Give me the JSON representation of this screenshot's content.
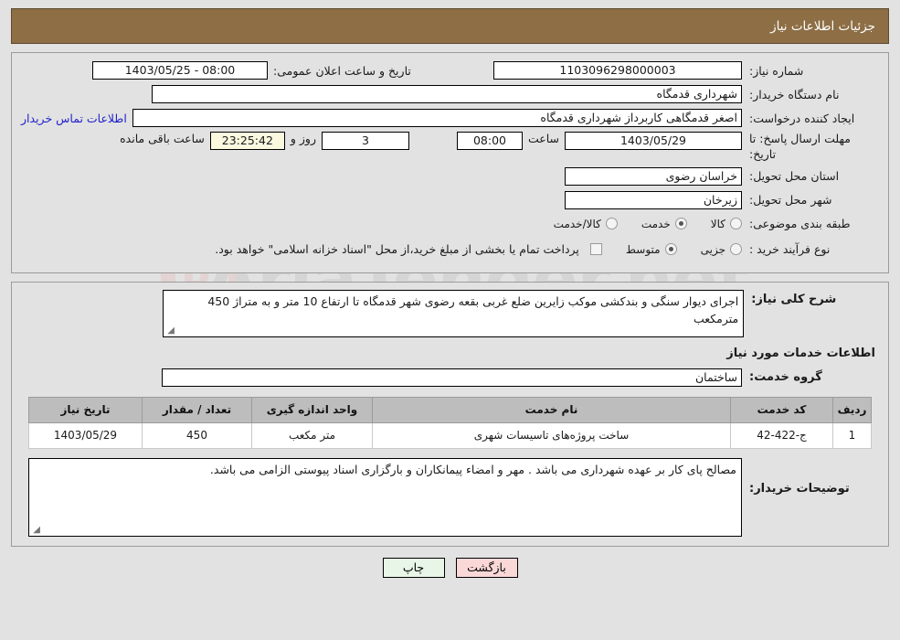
{
  "header": {
    "title": "جزئیات اطلاعات نیاز"
  },
  "top_form": {
    "need_number_label": "شماره نیاز:",
    "need_number_value": "1103096298000003",
    "public_announce_label": "تاریخ و ساعت اعلان عمومی:",
    "public_announce_value": "08:00 - 1403/05/25",
    "buyer_org_label": "نام دستگاه خریدار:",
    "buyer_org_value": "شهرداری قدمگاه",
    "requester_label": "ایجاد کننده درخواست:",
    "requester_value": "اصغر قدمگاهی کاربرداز شهرداری قدمگاه",
    "contact_link": "اطلاعات تماس خریدار",
    "deadline_label": "مهلت ارسال پاسخ: تا تاریخ:",
    "deadline_date": "1403/05/29",
    "hour_label": "ساعت",
    "deadline_time": "08:00",
    "days_value": "3",
    "days_label": "روز و",
    "countdown_value": "23:25:42",
    "countdown_label": "ساعت باقی مانده",
    "province_label": "استان محل تحویل:",
    "province_value": "خراسان رضوی",
    "city_label": "شهر محل تحویل:",
    "city_value": "زیرخان",
    "category_label": "طبقه بندی موضوعی:",
    "category_options": [
      {
        "label": "کالا",
        "selected": false
      },
      {
        "label": "خدمت",
        "selected": true
      },
      {
        "label": "کالا/خدمت",
        "selected": false
      }
    ],
    "process_label": "نوع فرآیند خرید :",
    "process_options": [
      {
        "label": "جزیی",
        "selected": false
      },
      {
        "label": "متوسط",
        "selected": true
      }
    ],
    "treasury_checkbox_checked": false,
    "treasury_note": "پرداخت تمام یا بخشی از مبلغ خرید،از محل \"اسناد خزانه اسلامی\" خواهد بود."
  },
  "summary": {
    "label": "شرح کلی نیاز:",
    "text": "اجرای دیوار سنگی و بندکشی موکب زایرین ضلع غربی بقعه رضوی شهر قدمگاه تا ارتفاع 10 متر و به متراژ 450 مترمکعب"
  },
  "services_section": {
    "title": "اطلاعات خدمات مورد نیاز",
    "group_label": "گروه خدمت:",
    "group_value": "ساختمان",
    "table": {
      "columns": [
        "ردیف",
        "کد خدمت",
        "نام خدمت",
        "واحد اندازه گیری",
        "تعداد / مقدار",
        "تاریخ نیاز"
      ],
      "rows": [
        {
          "index": "1",
          "code": "ج-422-42",
          "name": "ساخت پروژه‌های تاسیسات شهری",
          "unit": "متر مکعب",
          "quantity": "450",
          "date": "1403/05/29"
        }
      ]
    }
  },
  "buyer_notes": {
    "label": "توضیحات خریدار:",
    "text": "مصالح پای کار بر عهده شهرداری می باشد . مهر و امضاء پیمانکاران و بارگزاری اسناد پیوستی الزامی می باشد."
  },
  "footer": {
    "print_label": "چاپ",
    "back_label": "بازگشت"
  },
  "watermark": {
    "text": "AriaTender.net",
    "letter": "R"
  },
  "colors": {
    "header_bg": "#8d6e45",
    "page_bg": "#e2e2e2",
    "link": "#2222cc",
    "table_header_bg": "#bdbdbd",
    "print_btn_bg": "#e7f6e7",
    "back_btn_bg": "#fbd8d8",
    "countdown_bg": "#fbf8e0"
  }
}
